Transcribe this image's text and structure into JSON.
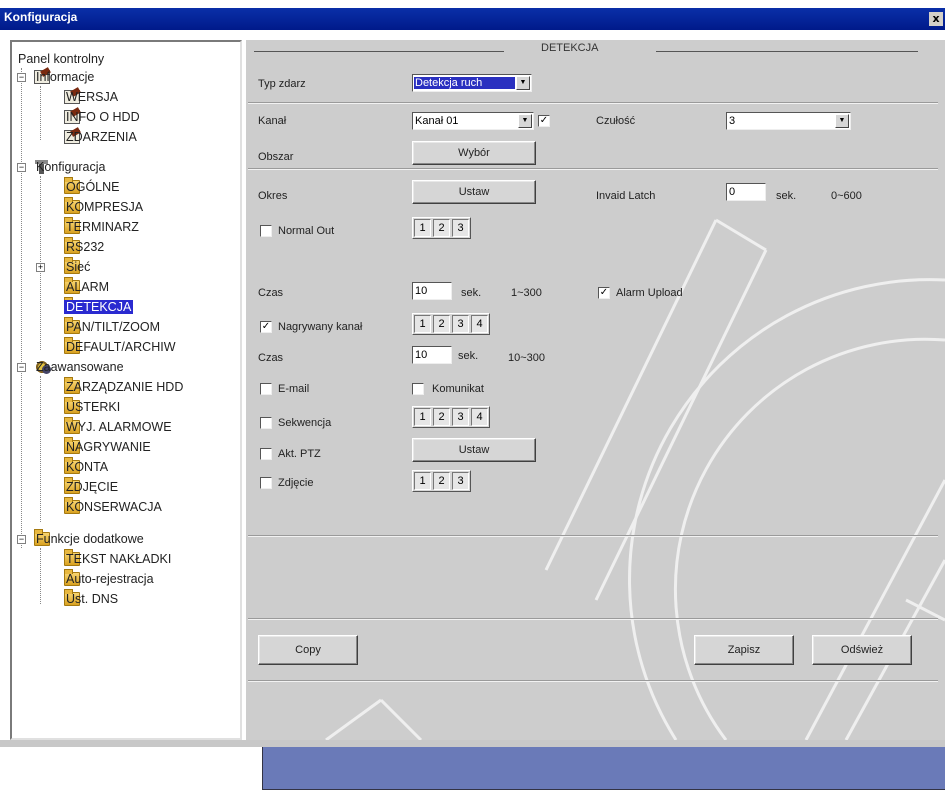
{
  "window": {
    "title": "Konfiguracja",
    "close": "x"
  },
  "tree": {
    "root": "Panel kontrolny",
    "informacje": {
      "label": "Informacje",
      "children": [
        "WERSJA",
        "INFO O HDD",
        "ZDARZENIA"
      ]
    },
    "konfiguracja": {
      "label": "Konfiguracja",
      "children": [
        "OGÓLNE",
        "KOMPRESJA",
        "TERMINARZ",
        "RS232",
        "Sieć",
        "ALARM",
        "DETEKCJA",
        "PAN/TILT/ZOOM",
        "DEFAULT/ARCHIW"
      ]
    },
    "zaawansowane": {
      "label": "Zaawansowane",
      "children": [
        "ZARZĄDZANIE HDD",
        "USTERKI",
        "WYJ. ALARMOWE",
        "NAGRYWANIE",
        "KONTA",
        "ZDJĘCIE",
        "KONSERWACJA"
      ]
    },
    "funkcje": {
      "label": "Funkcje dodatkowe",
      "children": [
        "TEKST NAKŁADKI",
        "Auto-rejestracja",
        "Ust. DNS"
      ]
    },
    "selected": "DETEKCJA"
  },
  "form": {
    "header": "DETEKCJA",
    "typ_zdarz": {
      "label": "Typ zdarz",
      "value": "Detekcja ruch"
    },
    "kanal": {
      "label": "Kanał",
      "value": "Kanał 01",
      "checked": "✓"
    },
    "czulosc": {
      "label": "Czułość",
      "value": "3"
    },
    "obszar": {
      "label": "Obszar",
      "button": "Wybór"
    },
    "okres": {
      "label": "Okres",
      "button": "Ustaw"
    },
    "invalid_latch": {
      "label": "Invaid Latch",
      "value": "0",
      "unit": "sek.",
      "range": "0~600"
    },
    "normal_out": {
      "label": "Normal Out",
      "values": [
        "1",
        "2",
        "3"
      ]
    },
    "czas1": {
      "label": "Czas",
      "value": "10",
      "unit": "sek.",
      "range": "1~300"
    },
    "alarm_upload": {
      "label": "Alarm Upload",
      "checked": "✓"
    },
    "nagrywany_kanal": {
      "label": "Nagrywany kanał",
      "checked": "✓",
      "values": [
        "1",
        "2",
        "3",
        "4"
      ]
    },
    "czas2": {
      "label": "Czas",
      "value": "10",
      "unit": "sek.",
      "range": "10~300"
    },
    "email": {
      "label": "E-mail"
    },
    "komunikat": {
      "label": "Komunikat"
    },
    "sekwencja": {
      "label": "Sekwencja",
      "values": [
        "1",
        "2",
        "3",
        "4"
      ]
    },
    "akt_ptz": {
      "label": "Akt. PTZ",
      "button": "Ustaw"
    },
    "zdjecie": {
      "label": "Zdjęcie",
      "values": [
        "1",
        "2",
        "3"
      ]
    }
  },
  "buttons": {
    "copy": "Copy",
    "zapisz": "Zapisz",
    "odswiez": "Odśwież"
  }
}
